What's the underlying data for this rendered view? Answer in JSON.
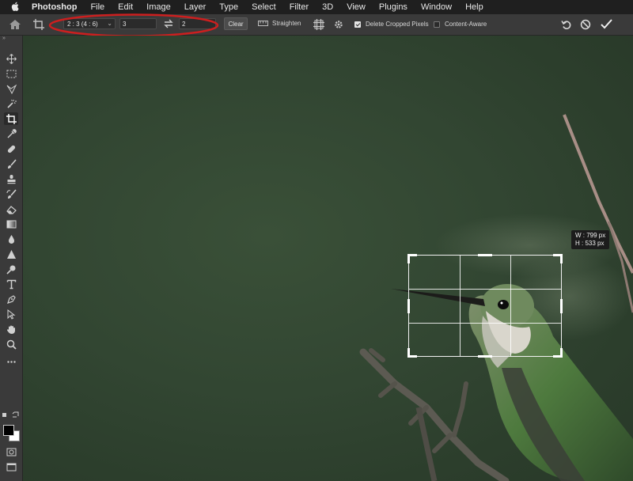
{
  "menu": {
    "apple_icon": "apple-logo",
    "app": "Photoshop",
    "items": [
      "File",
      "Edit",
      "Image",
      "Layer",
      "Type",
      "Select",
      "Filter",
      "3D",
      "View",
      "Plugins",
      "Window",
      "Help"
    ]
  },
  "options": {
    "ratio_value": "2 : 3 (4 : 6)",
    "width_value": "3",
    "height_value": "2",
    "clear_label": "Clear",
    "straighten_label": "Straighten",
    "delete_cropped_label": "Delete Cropped Pixels",
    "delete_cropped_checked": true,
    "content_aware_label": "Content-Aware",
    "content_aware_checked": false,
    "annotation_color": "#cc1f1f"
  },
  "toolbar": {
    "tools": [
      "move",
      "marquee",
      "lasso",
      "magic-wand",
      "crop",
      "eyedropper",
      "spot-healing",
      "brush",
      "clone-stamp",
      "history-brush",
      "eraser",
      "gradient",
      "blur",
      "dodge",
      "pen",
      "type",
      "path-selection",
      "shape",
      "hand",
      "zoom",
      "more"
    ],
    "active_tool": "crop",
    "foreground_color": "#000000",
    "background_color": "#ffffff"
  },
  "canvas": {
    "background_color": "#324632",
    "crop_overlay": {
      "width_label": "W : 799 px",
      "height_label": "H : 533 px"
    }
  }
}
